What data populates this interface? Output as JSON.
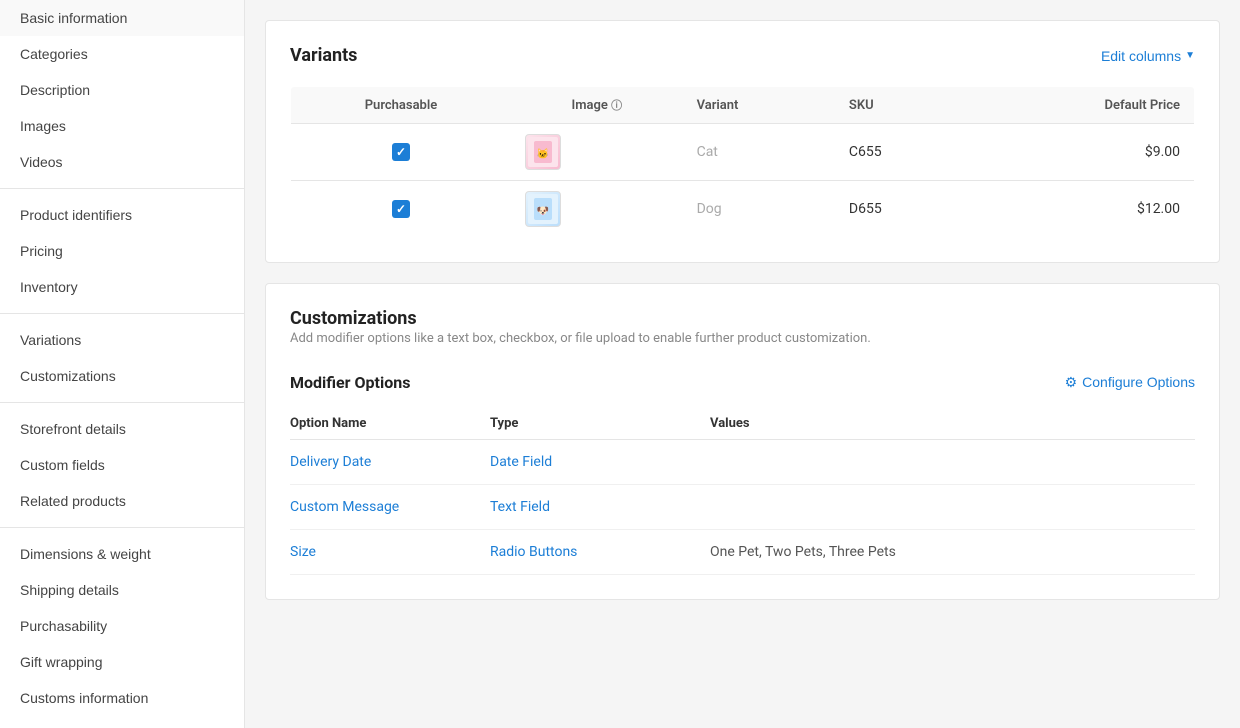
{
  "sidebar": {
    "items": [
      {
        "label": "Basic information",
        "id": "basic-information"
      },
      {
        "label": "Categories",
        "id": "categories"
      },
      {
        "label": "Description",
        "id": "description"
      },
      {
        "label": "Images",
        "id": "images"
      },
      {
        "label": "Videos",
        "id": "videos"
      },
      {
        "label": "divider1",
        "type": "divider"
      },
      {
        "label": "Product identifiers",
        "id": "product-identifiers"
      },
      {
        "label": "Pricing",
        "id": "pricing"
      },
      {
        "label": "Inventory",
        "id": "inventory"
      },
      {
        "label": "divider2",
        "type": "divider"
      },
      {
        "label": "Variations",
        "id": "variations"
      },
      {
        "label": "Customizations",
        "id": "customizations"
      },
      {
        "label": "divider3",
        "type": "divider"
      },
      {
        "label": "Storefront details",
        "id": "storefront-details"
      },
      {
        "label": "Custom fields",
        "id": "custom-fields"
      },
      {
        "label": "Related products",
        "id": "related-products"
      },
      {
        "label": "divider4",
        "type": "divider"
      },
      {
        "label": "Dimensions & weight",
        "id": "dimensions-weight"
      },
      {
        "label": "Shipping details",
        "id": "shipping-details"
      },
      {
        "label": "Purchasability",
        "id": "purchasability"
      },
      {
        "label": "Gift wrapping",
        "id": "gift-wrapping"
      },
      {
        "label": "Customs information",
        "id": "customs-information"
      }
    ]
  },
  "variants": {
    "section_title": "Variants",
    "edit_columns_label": "Edit columns",
    "table": {
      "headers": [
        "Purchasable",
        "Image",
        "Variant",
        "SKU",
        "Default Price"
      ],
      "rows": [
        {
          "purchasable": true,
          "image_type": "cat",
          "variant": "Cat",
          "sku": "C655",
          "price": "$9.00"
        },
        {
          "purchasable": true,
          "image_type": "dog",
          "variant": "Dog",
          "sku": "D655",
          "price": "$12.00"
        }
      ]
    }
  },
  "customizations": {
    "section_title": "Customizations",
    "description": "Add modifier options like a text box, checkbox, or file upload to enable further product customization.",
    "modifier_options_title": "Modifier Options",
    "configure_options_label": "Configure Options",
    "table": {
      "headers": [
        "Option Name",
        "Type",
        "Values"
      ],
      "rows": [
        {
          "option_name": "Delivery Date",
          "type": "Date Field",
          "values": ""
        },
        {
          "option_name": "Custom Message",
          "type": "Text Field",
          "values": ""
        },
        {
          "option_name": "Size",
          "type": "Radio Buttons",
          "values": "One Pet, Two Pets, Three Pets"
        }
      ]
    }
  }
}
